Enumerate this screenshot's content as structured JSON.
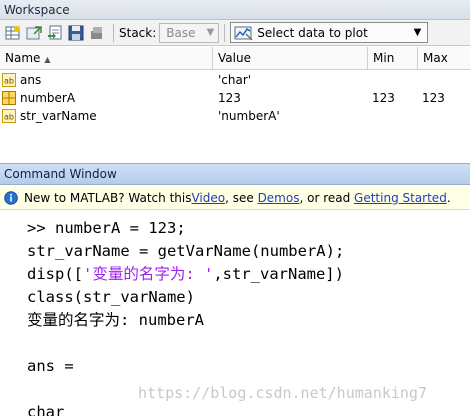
{
  "workspace": {
    "title": "Workspace",
    "toolbar": {
      "stack_label": "Stack:",
      "stack_value": "Base",
      "plot_label": "Select data to plot"
    },
    "columns": {
      "name": "Name",
      "value": "Value",
      "min": "Min",
      "max": "Max"
    },
    "rows": [
      {
        "name": "ans",
        "value": "'char'",
        "min": "",
        "max": "",
        "icon": "char-variable-icon"
      },
      {
        "name": "numberA",
        "value": "123",
        "min": "123",
        "max": "123",
        "icon": "numeric-variable-icon"
      },
      {
        "name": "str_varName",
        "value": "'numberA'",
        "min": "",
        "max": "",
        "icon": "char-variable-icon"
      }
    ]
  },
  "command_window": {
    "title": "Command Window",
    "banner": {
      "prefix": "New to MATLAB? Watch this ",
      "video": "Video",
      "mid1": ", see ",
      "demos": "Demos",
      "mid2": ", or read ",
      "getting_started": "Getting Started",
      "suffix": "."
    },
    "lines": {
      "l1_prompt": ">> ",
      "l1_code": "numberA = 123;",
      "l2": "str_varName = getVarName(numberA);",
      "l3_a": "disp([",
      "l3_str": "'变量的名字为: '",
      "l3_b": ",str_varName])",
      "l4": "class(str_varName)",
      "l5": "变量的名字为: numberA",
      "l6": "",
      "l7": "ans =",
      "l8": "",
      "l9": "char"
    },
    "watermark": "https://blog.csdn.net/humanking7"
  }
}
